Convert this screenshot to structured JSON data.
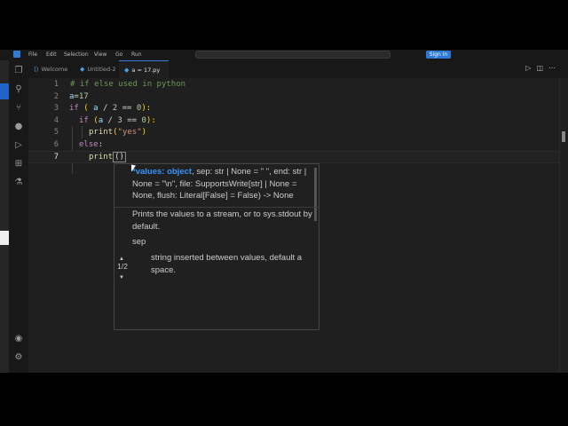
{
  "titlebar": {
    "menu": [
      "File",
      "Edit",
      "Selection",
      "View",
      "Go",
      "Run"
    ],
    "signin": "Sign in"
  },
  "tabs": [
    {
      "label": "Welcome",
      "icon": "vscode-icon",
      "active": false
    },
    {
      "label": "Untitled-2",
      "icon": "file-icon",
      "active": false
    },
    {
      "label": "a = 17.py",
      "icon": "python-icon",
      "active": true,
      "modified": true
    }
  ],
  "editor": {
    "lines": [
      {
        "n": "1"
      },
      {
        "n": "2"
      },
      {
        "n": "3"
      },
      {
        "n": "4"
      },
      {
        "n": "5"
      },
      {
        "n": "6"
      },
      {
        "n": "7"
      }
    ],
    "comment": "# if else used in python",
    "assign_var": "a",
    "assign_op": "=",
    "assign_val": "17",
    "kw_if": "if",
    "kw_else": "else",
    "cond1_open": "( ",
    "cond1_var": "a",
    "cond1_div": " / ",
    "cond1_num": "2",
    "cond1_eq": " == ",
    "cond1_zero": "0",
    "cond1_close": "):",
    "cond2_open": " (",
    "cond2_var": "a",
    "cond2_div": " / ",
    "cond2_num": "3",
    "cond2_eq": " == ",
    "cond2_zero": "0",
    "cond2_close": "):",
    "print_fn": "print",
    "print_open": "(",
    "print_str": "\"yes\"",
    "print_close": ")",
    "else_colon": ":",
    "print2_parens": "()"
  },
  "hint": {
    "sig_active": "*values: object",
    "sig_rest": ", sep: str | None = \" \", end: str | None = \"\\n\", file: SupportsWrite[str] | None = None, flush: Literal[False] = False) -> None",
    "doc": "Prints the values to a stream, or to sys.stdout by default.",
    "param_name": "sep",
    "param_desc": "string inserted between values, default a space.",
    "counter": "1/2"
  },
  "colors": {
    "accent": "#3794ff",
    "keyword": "#c586c0",
    "comment": "#6a9955",
    "string": "#ce9178",
    "function": "#dcdcaa"
  }
}
